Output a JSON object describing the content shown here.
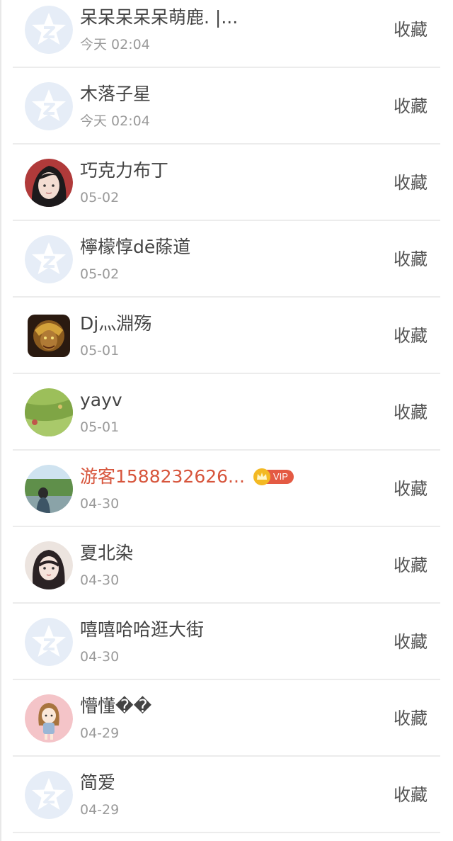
{
  "colors": {
    "name_text": "#444444",
    "vip_name_text": "#d7553c",
    "time_text": "#9a9a9a",
    "divider": "#ececec",
    "default_avatar_bg": "#e6edf7",
    "default_avatar_star": "#ffffff"
  },
  "rows": [
    {
      "name": "呆呆呆呆呆萌鹿. |...",
      "time": "今天 02:04",
      "action": "收藏",
      "avatar": "default-avatar-icon",
      "vip": false
    },
    {
      "name": "木落子星",
      "time": "今天 02:04",
      "action": "收藏",
      "avatar": "default-avatar-icon",
      "vip": false
    },
    {
      "name": "巧克力布丁",
      "time": "05-02",
      "action": "收藏",
      "avatar": "girl-photo-avatar",
      "vip": false
    },
    {
      "name": "檸檬惇dē蒢道",
      "time": "05-02",
      "action": "收藏",
      "avatar": "default-avatar-icon",
      "vip": false
    },
    {
      "name": "Dj灬淵殇",
      "time": "05-01",
      "action": "收藏",
      "avatar": "game-hero-avatar",
      "vip": false
    },
    {
      "name": "yayv",
      "time": "05-01",
      "action": "收藏",
      "avatar": "green-field-avatar",
      "vip": false
    },
    {
      "name": "游客1588232626...",
      "time": "04-30",
      "action": "收藏",
      "avatar": "landscape-person-avatar",
      "vip": true,
      "vip_label": "VIP"
    },
    {
      "name": "夏北染",
      "time": "04-30",
      "action": "收藏",
      "avatar": "girl-selfie-avatar",
      "vip": false
    },
    {
      "name": "嘻嘻哈哈逛大街",
      "time": "04-30",
      "action": "收藏",
      "avatar": "default-avatar-icon",
      "vip": false
    },
    {
      "name": "懵懂��",
      "time": "04-29",
      "action": "收藏",
      "avatar": "cartoon-girl-avatar",
      "vip": false
    },
    {
      "name": "简爱",
      "time": "04-29",
      "action": "收藏",
      "avatar": "default-avatar-icon",
      "vip": false
    }
  ]
}
